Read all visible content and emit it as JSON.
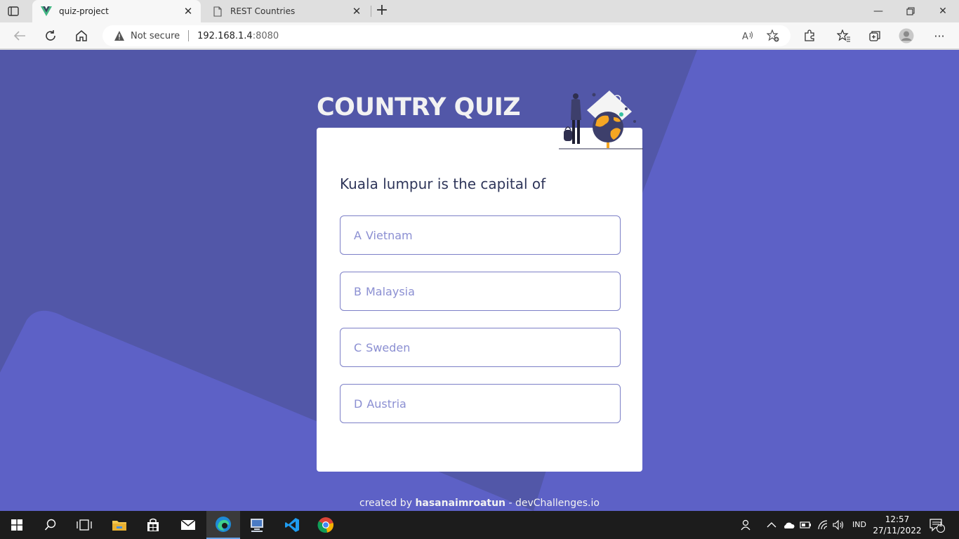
{
  "browser": {
    "tabs": [
      {
        "title": "quiz-project",
        "active": true,
        "icon": "vue-logo-icon"
      },
      {
        "title": "REST Countries",
        "active": false,
        "icon": "page-icon"
      }
    ],
    "address": {
      "security_label": "Not secure",
      "host": "192.168.1.4",
      "port": ":8080"
    }
  },
  "quiz": {
    "title": "COUNTRY QUIZ",
    "question": "Kuala lumpur is the capital of",
    "options": [
      {
        "letter": "A",
        "text": "Vietnam"
      },
      {
        "letter": "B",
        "text": "Malaysia"
      },
      {
        "letter": "C",
        "text": "Sweden"
      },
      {
        "letter": "D",
        "text": "Austria"
      }
    ]
  },
  "footer": {
    "prefix": "created by ",
    "author": "hasanaimroatun",
    "suffix": " - devChallenges.io"
  },
  "taskbar": {
    "language": "IND",
    "time": "12:57",
    "date": "27/11/2022",
    "notification_count": "1"
  },
  "colors": {
    "page_bg": "#5d61c6",
    "shape_dark": "#5257a8",
    "option_border": "#7c7fc7",
    "option_text": "#8b8fd2",
    "question_text": "#2f365a",
    "accent_orange": "#f5a623"
  }
}
